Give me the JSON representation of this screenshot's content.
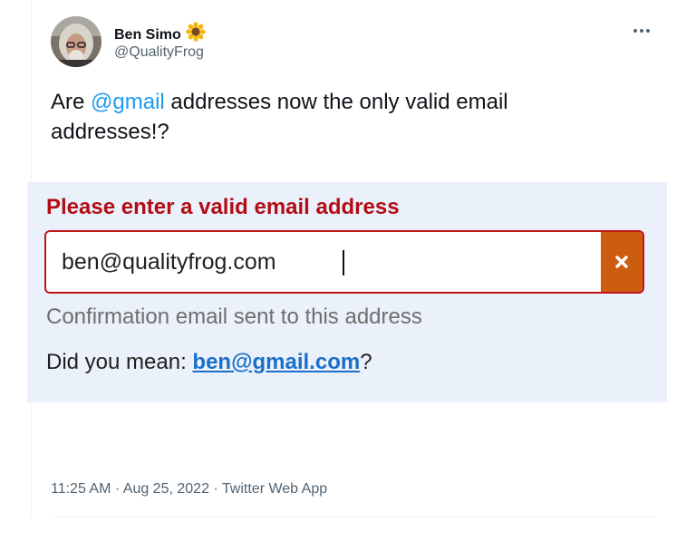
{
  "tweet": {
    "author": {
      "name": "Ben Simo",
      "handle": "@QualityFrog",
      "badge_icon": "sunflower-emoji"
    },
    "text_before": "Are ",
    "mention": "@gmail",
    "text_after": " addresses now the only valid email addresses!?",
    "timestamp": "11:25 AM",
    "separator": " · ",
    "date": "Aug 25, 2022",
    "source": "Twitter Web App",
    "menu_icon": "more-horizontal-icon"
  },
  "form": {
    "error_label": "Please enter a valid email address",
    "email_value": "ben@qualityfrog.com",
    "clear_icon": "close-x-icon",
    "confirmation_text": "Confirmation email sent to this address",
    "suggestion_prefix": "Did you mean: ",
    "suggestion_email": "ben@gmail.com",
    "suggestion_suffix": "?"
  },
  "colors": {
    "mention": "#1d9bf0",
    "error": "#b20d14",
    "clear_button": "#cc5c0e",
    "panel_bg": "#ebf1fb",
    "link": "#1a6fc9",
    "muted": "#536471"
  }
}
